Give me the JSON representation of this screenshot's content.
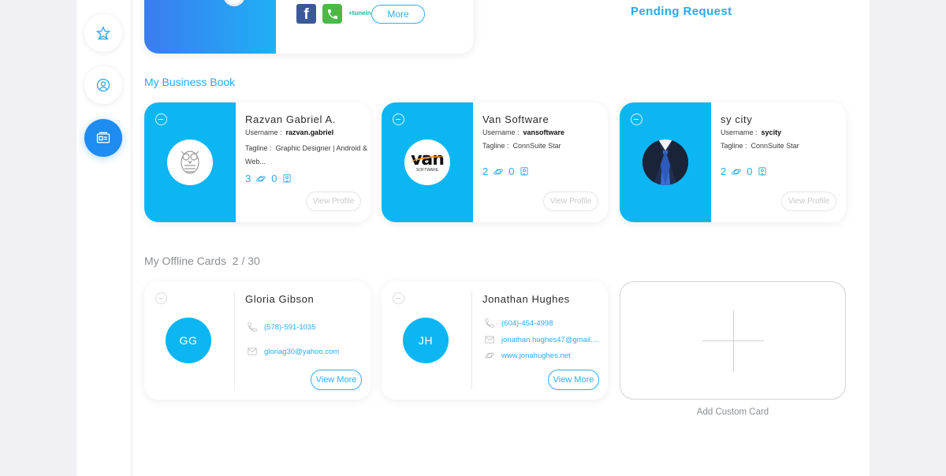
{
  "top_card": {
    "more_label": "More",
    "tunein_label": "+tunein",
    "facebook_glyph": "f"
  },
  "pending_request": "Pending Request",
  "business_book": {
    "title": "My Business Book",
    "cards": [
      {
        "name": "Razvan Gabriel A.",
        "username_label": "Username :",
        "username": "razvan.gabriel",
        "tagline_label": "Tagline :",
        "tagline": "Graphic Designer | Android & Web...",
        "stat_a": "3",
        "stat_b": "0",
        "view_profile": "View Profile"
      },
      {
        "name": "Van Software",
        "username_label": "Username :",
        "username": "vansoftware",
        "tagline_label": "Tagline :",
        "tagline": "ConnSuite Star",
        "stat_a": "2",
        "stat_b": "0",
        "view_profile": "View Profile",
        "logo_text": "van",
        "logo_subtext": "SOFTWARE"
      },
      {
        "name": "sy city",
        "username_label": "Username :",
        "username": "sycity",
        "tagline_label": "Tagline :",
        "tagline": "ConnSuite Star",
        "stat_a": "2",
        "stat_b": "0",
        "view_profile": "View Profile"
      }
    ]
  },
  "offline_cards": {
    "title": "My Offline Cards",
    "count": "2 / 30",
    "cards": [
      {
        "initials": "GG",
        "name": "Gloria Gibson",
        "phone": "(578)-591-1035",
        "email": "gloriag30@yahoo.com",
        "view_more": "View More"
      },
      {
        "initials": "JH",
        "name": "Jonathan Hughes",
        "phone": "(604)-454-4998",
        "email": "jonathan.hughes47@gmail....",
        "website": "www.jonahughes.net",
        "view_more": "View More"
      }
    ],
    "add_label": "Add Custom Card"
  },
  "colors": {
    "accent": "#29aaef",
    "card_blue": "#0bb6f3",
    "sidebar_active": "#1e8cf0"
  }
}
